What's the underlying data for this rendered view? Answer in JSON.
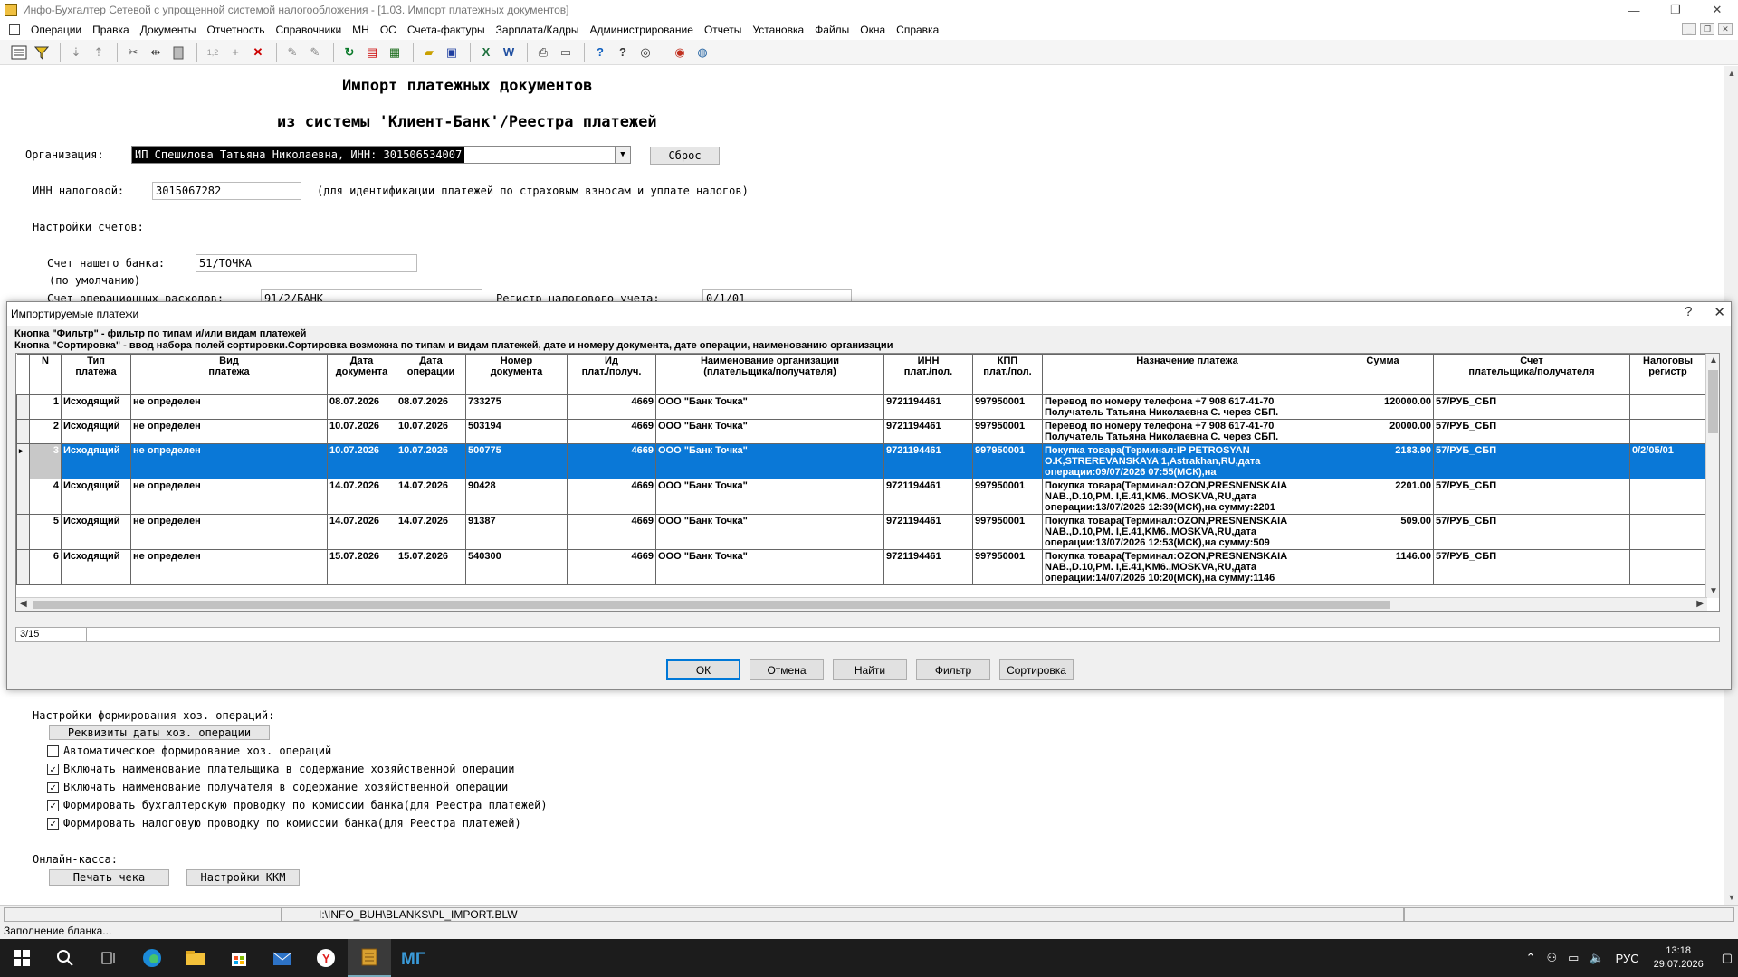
{
  "window": {
    "title": "Инфо-Бухгалтер Сетевой с упрощенной системой налогообложения - [1.03. Импорт платежных документов]",
    "controls": [
      "—",
      "❐",
      "✕"
    ]
  },
  "menu": [
    "Операции",
    "Правка",
    "Документы",
    "Отчетность",
    "Справочники",
    "МН",
    "ОС",
    "Счета-фактуры",
    "Зарплата/Кадры",
    "Администрирование",
    "Отчеты",
    "Установка",
    "Файлы",
    "Окна",
    "Справка"
  ],
  "toolbar_icons": [
    "form-icon",
    "filter-icon",
    "sort-asc-icon",
    "sort-desc-icon",
    "cut-icon",
    "split-icon",
    "paste-icon",
    "numbering-icon",
    "add-icon",
    "delete-icon",
    "tool1-icon",
    "tool2-icon",
    "refresh-icon",
    "pdf-icon",
    "calc-icon",
    "open-icon",
    "save-icon",
    "excel-icon",
    "word-icon",
    "print-icon",
    "preview-icon",
    "help-icon",
    "context-help-icon",
    "compass-icon",
    "web-icon",
    "globe-icon"
  ],
  "form": {
    "heading1": "Импорт платежных документов",
    "heading2": "из системы 'Клиент-Банк'/Реестра платежей",
    "org_label": "Организация:",
    "org_value": "ИП Спешилова Татьяна Николаевна, ИНН: 301506534007",
    "reset_label": "Сброс",
    "inn_label": "ИНН налоговой:",
    "inn_value": "3015067282",
    "inn_hint": "(для идентификации платежей по страховым взносам и уплате налогов)",
    "accounts_label": "Настройки счетов:",
    "bank_account_label": "Счет нашего банка:",
    "bank_account_value": "51/ТОЧКА",
    "default_label": "(по умолчанию)",
    "ops_label": "Счет операционных расходов:",
    "ops_value": "91/2/БАНК",
    "tax_register_label": "Регистр налогового учета:",
    "tax_register_value": "0/1/01",
    "hoz_settings_label": "Настройки формирования хоз. операций:",
    "hoz_date_btn": "Реквизиты даты хоз. операции",
    "checkboxes": [
      {
        "label": "Автоматическое формирование хоз. операций",
        "checked": ""
      },
      {
        "label": "Включать наименование плательщика в содержание хозяйственной операции",
        "checked": "✓"
      },
      {
        "label": "Включать наименование получателя в содержание хозяйственной операции",
        "checked": "✓"
      },
      {
        "label": "Формировать бухгалтерскую проводку по комиссии банка(для Реестра платежей)",
        "checked": "✓"
      },
      {
        "label": "Формировать налоговую проводку по комиссии банка(для Реестра платежей)",
        "checked": "✓"
      }
    ],
    "online_kassa_label": "Онлайн-касса:",
    "print_check_btn": "Печать чека",
    "kkm_settings_btn": "Настройки ККМ"
  },
  "dialog": {
    "title": "Импортируемые платежи",
    "help_btn": "?",
    "close_btn": "✕",
    "hint1": "Кнопка \"Фильтр\" - фильтр по типам и/или видам платежей",
    "hint2": "Кнопка \"Сортировка\" - ввод набора полей сортировки.Сортировка возможна по типам и видам платежей, дате и номеру документа, дате операции, наименованию организации",
    "columns": [
      {
        "h1": "N",
        "h2": ""
      },
      {
        "h1": "Тип",
        "h2": "платежа"
      },
      {
        "h1": "Вид",
        "h2": "платежа"
      },
      {
        "h1": "Дата",
        "h2": "документа"
      },
      {
        "h1": "Дата",
        "h2": "операции"
      },
      {
        "h1": "Номер",
        "h2": "документа"
      },
      {
        "h1": "Ид",
        "h2": "плат./получ."
      },
      {
        "h1": "Наименование организации",
        "h2": "(плательщика/получателя)"
      },
      {
        "h1": "ИНН",
        "h2": "плат./пол."
      },
      {
        "h1": "КПП",
        "h2": "плат./пол."
      },
      {
        "h1": "Назначение платежа",
        "h2": ""
      },
      {
        "h1": "Сумма",
        "h2": ""
      },
      {
        "h1": "Счет",
        "h2": "плательщика/получателя"
      },
      {
        "h1": "Налоговы",
        "h2": "регистр"
      }
    ],
    "rows": [
      {
        "n": "1",
        "type": "Исходящий",
        "kind": "не определен",
        "doc_date": "08.07.2026",
        "op_date": "08.07.2026",
        "doc_no": "733275",
        "id": "4669",
        "org": "ООО \"Банк Точка\"",
        "inn": "9721194461",
        "kpp": "997950001",
        "purpose": "Перевод по номеру телефона +7 908 617-41-70 Получатель Татьяна Николаевна С. через СБП.",
        "sum": "120000.00",
        "account": "57/РУБ_СБП",
        "tax_reg": ""
      },
      {
        "n": "2",
        "type": "Исходящий",
        "kind": "не определен",
        "doc_date": "10.07.2026",
        "op_date": "10.07.2026",
        "doc_no": "503194",
        "id": "4669",
        "org": "ООО \"Банк Точка\"",
        "inn": "9721194461",
        "kpp": "997950001",
        "purpose": "Перевод по номеру телефона +7 908 617-41-70 Получатель Татьяна Николаевна С. через СБП.",
        "sum": "20000.00",
        "account": "57/РУБ_СБП",
        "tax_reg": ""
      },
      {
        "n": "3",
        "type": "Исходящий",
        "kind": "не определен",
        "doc_date": "10.07.2026",
        "op_date": "10.07.2026",
        "doc_no": "500775",
        "id": "4669",
        "org": "ООО \"Банк Точка\"",
        "inn": "9721194461",
        "kpp": "997950001",
        "purpose": "Покупка товара(Терминал:IP PETROSYAN O.K,STREREVANSKAYA 1,Astrakhan,RU,дата операции:09/07/2026 07:55(МСК),на",
        "sum": "2183.90",
        "account": "57/РУБ_СБП",
        "tax_reg": "0/2/05/01"
      },
      {
        "n": "4",
        "type": "Исходящий",
        "kind": "не определен",
        "doc_date": "14.07.2026",
        "op_date": "14.07.2026",
        "doc_no": "90428",
        "id": "4669",
        "org": "ООО \"Банк Точка\"",
        "inn": "9721194461",
        "kpp": "997950001",
        "purpose": "Покупка товара(Терминал:OZON,PRESNENSKAIA NAB.,D.10,PM. I,E.41,KM6.,MOSKVA,RU,дата операции:13/07/2026 12:39(МСК),на сумму:2201",
        "sum": "2201.00",
        "account": "57/РУБ_СБП",
        "tax_reg": ""
      },
      {
        "n": "5",
        "type": "Исходящий",
        "kind": "не определен",
        "doc_date": "14.07.2026",
        "op_date": "14.07.2026",
        "doc_no": "91387",
        "id": "4669",
        "org": "ООО \"Банк Точка\"",
        "inn": "9721194461",
        "kpp": "997950001",
        "purpose": "Покупка товара(Терминал:OZON,PRESNENSKAIA NAB.,D.10,PM. I,E.41,KM6.,MOSKVA,RU,дата операции:13/07/2026 12:53(МСК),на сумму:509",
        "sum": "509.00",
        "account": "57/РУБ_СБП",
        "tax_reg": ""
      },
      {
        "n": "6",
        "type": "Исходящий",
        "kind": "не определен",
        "doc_date": "15.07.2026",
        "op_date": "15.07.2026",
        "doc_no": "540300",
        "id": "4669",
        "org": "ООО \"Банк Точка\"",
        "inn": "9721194461",
        "kpp": "997950001",
        "purpose": "Покупка товара(Терминал:OZON,PRESNENSKAIA NAB.,D.10,PM. I,E.41,KM6.,MOSKVA,RU,дата операции:14/07/2026 10:20(МСК),на сумму:1146",
        "sum": "1146.00",
        "account": "57/РУБ_СБП",
        "tax_reg": ""
      }
    ],
    "counter": "3/15",
    "buttons": {
      "ok": "ОК",
      "cancel": "Отмена",
      "find": "Найти",
      "filter": "Фильтр",
      "sort": "Сортировка"
    }
  },
  "statusbar": {
    "path": "I:\\INFO_BUH\\BLANKS\\PL_IMPORT.BLW",
    "message": "Заполнение бланка..."
  },
  "taskbar": {
    "lang": "РУС",
    "time": "13:18",
    "date": "29.07.2026"
  },
  "colors": {
    "selection": "#0a78d7",
    "taskbar": "#1c1c1c"
  }
}
